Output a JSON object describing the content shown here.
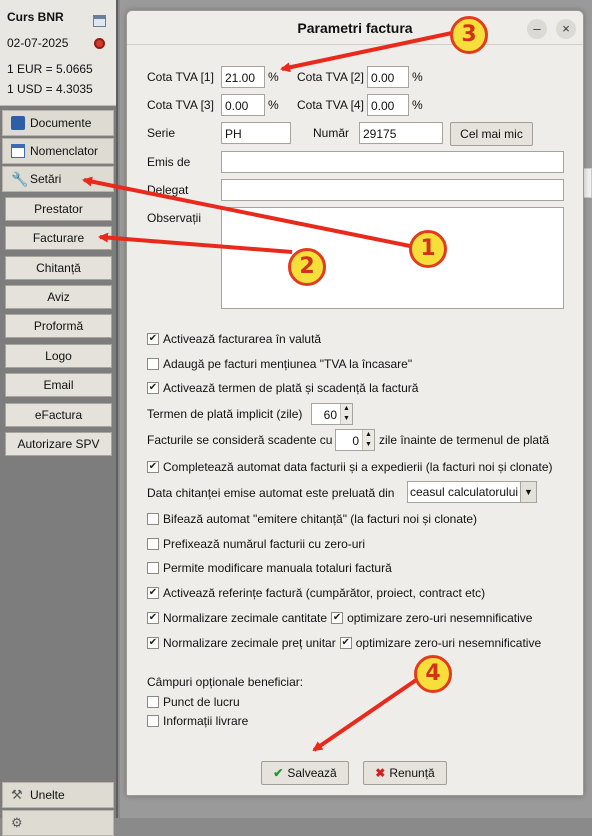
{
  "bnr": {
    "title": "Curs BNR",
    "date": "02-07-2025",
    "eur": "1 EUR = 5.0665",
    "usd": "1 USD = 4.3035"
  },
  "sidebar": {
    "documente": "Documente",
    "nomenclator": "Nomenclator",
    "setari": "Setări",
    "sub_items": [
      "Prestator",
      "Facturare",
      "Chitanță",
      "Aviz",
      "Proformă",
      "Logo",
      "Email",
      "eFactura",
      "Autorizare SPV"
    ],
    "unelte": "Unelte"
  },
  "dialog": {
    "title": "Parametri factura",
    "minimize": "–",
    "close": "×",
    "tva": {
      "label1": "Cota TVA [1]",
      "value1": "21.00",
      "label2": "Cota TVA [2]",
      "value2": "0.00",
      "label3": "Cota TVA [3]",
      "value3": "0.00",
      "label4": "Cota TVA [4]",
      "value4": "0.00",
      "percent": "%"
    },
    "serie_label": "Serie",
    "serie_value": "PH",
    "numar_label": "Număr",
    "numar_value": "29175",
    "cel_mai_mic": "Cel mai mic",
    "emis_de_label": "Emis de",
    "emis_de_value": "",
    "delegat_label": "Delegat",
    "delegat_value": "",
    "observatii_label": "Observații",
    "observatii_value": "",
    "options": {
      "valuta": "Activează facturarea în valută",
      "tva_incasare": "Adaugă pe facturi mențiunea \"TVA la încasare\"",
      "termen_plata": "Activează termen de plată și scadență la factură",
      "termen_implicit_label": "Termen de plată implicit (zile)",
      "termen_implicit_value": "60",
      "scadente_label_a": "Facturile se consideră scadente cu",
      "scadente_value": "0",
      "scadente_label_b": "zile înainte de termenul de plată",
      "completeaza_data": "Completează automat data facturii și a expedierii (la facturi noi și clonate)",
      "data_chitantei_label": "Data chitanței emise automat este preluată din",
      "data_chitantei_value": "ceasul calculatorului",
      "emitere_chitanta": "Bifează automat \"emitere chitanță\" (la facturi noi și clonate)",
      "prefixeaza": "Prefixează numărul facturii cu zero-uri",
      "modificare_totaluri": "Permite modificare manuala totaluri factură",
      "referinte": "Activează referințe factură (cumpărător, proiect, contract etc)",
      "zecimale_cantitate": "Normalizare zecimale cantitate",
      "zecimale_pret": "Normalizare zecimale preț unitar",
      "optimizare": "optimizare zero-uri nesemnificative"
    },
    "campuri_label": "Câmpuri opționale beneficiar:",
    "punct_lucru": "Punct de lucru",
    "informatii_livrare": "Informații livrare",
    "save": "Salvează",
    "cancel": "Renunță"
  },
  "annotations": [
    "1",
    "2",
    "3",
    "4"
  ],
  "colors": {
    "arrow": "#e8291c",
    "badge_fill": "#f6df3a",
    "save_icon": "#1f9a2b",
    "cancel_icon": "#d11f1f"
  }
}
